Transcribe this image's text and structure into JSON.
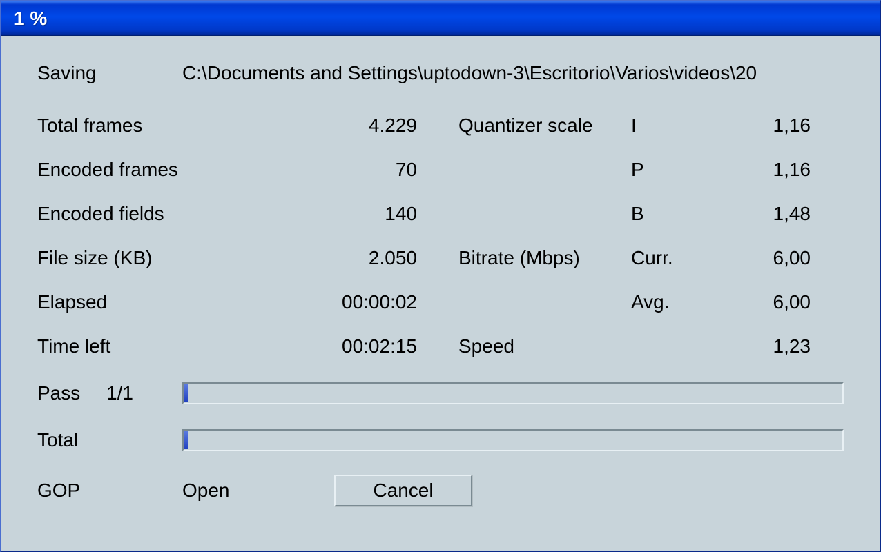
{
  "titlebar": {
    "title": "1 %"
  },
  "saving": {
    "label": "Saving",
    "path": "C:\\Documents and Settings\\uptodown-3\\Escritorio\\Varios\\videos\\20"
  },
  "stats": {
    "total_frames": {
      "label": "Total frames",
      "value": "4.229"
    },
    "encoded_frames": {
      "label": "Encoded frames",
      "value": "70"
    },
    "encoded_fields": {
      "label": "Encoded fields",
      "value": "140"
    },
    "file_size": {
      "label": "File size (KB)",
      "value": "2.050"
    },
    "elapsed": {
      "label": "Elapsed",
      "value": "00:00:02"
    },
    "time_left": {
      "label": "Time left",
      "value": "00:02:15"
    }
  },
  "quantizer": {
    "label": "Quantizer scale",
    "i": {
      "label": "I",
      "value": "1,16"
    },
    "p": {
      "label": "P",
      "value": "1,16"
    },
    "b": {
      "label": "B",
      "value": "1,48"
    }
  },
  "bitrate": {
    "label": "Bitrate (Mbps)",
    "curr": {
      "label": "Curr.",
      "value": "6,00"
    },
    "avg": {
      "label": "Avg.",
      "value": "6,00"
    }
  },
  "speed": {
    "label": "Speed",
    "value": "1,23"
  },
  "pass": {
    "label": "Pass",
    "value": "1/1",
    "percent": 1
  },
  "total": {
    "label": "Total",
    "percent": 1
  },
  "gop": {
    "label": "GOP",
    "value": "Open"
  },
  "buttons": {
    "cancel": "Cancel"
  }
}
